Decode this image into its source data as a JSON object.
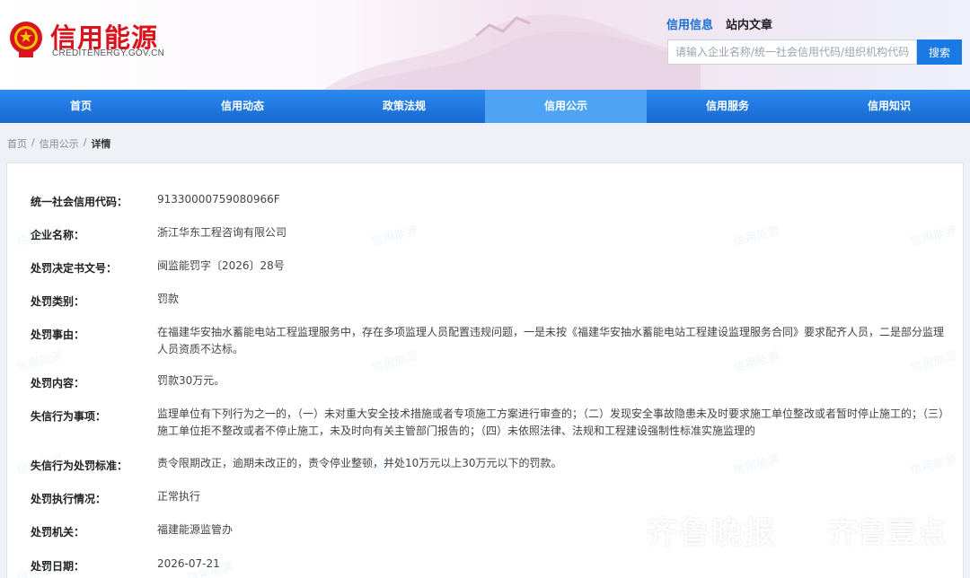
{
  "site": {
    "name": "信用能源",
    "domain": "CREDITENERGY.GOV.CN"
  },
  "search": {
    "tabs": [
      "信用信息",
      "站内文章"
    ],
    "placeholder": "请输入企业名称/统一社会信用代码/组织机构代码",
    "button": "搜索"
  },
  "nav": [
    "首页",
    "信用动态",
    "政策法规",
    "信用公示",
    "信用服务",
    "信用知识"
  ],
  "breadcrumb": [
    "首页",
    "信用公示",
    "详情"
  ],
  "details": [
    {
      "label": "统一社会信用代码：",
      "value": "91330000759080966F"
    },
    {
      "label": "企业名称：",
      "value": "浙江华东工程咨询有限公司"
    },
    {
      "label": "处罚决定书文号：",
      "value": "闽监能罚字〔2026〕28号"
    },
    {
      "label": "处罚类别：",
      "value": "罚款"
    },
    {
      "label": "处罚事由：",
      "value": "在福建华安抽水蓄能电站工程监理服务中，存在多项监理人员配置违规问题，一是未按《福建华安抽水蓄能电站工程建设监理服务合同》要求配齐人员，二是部分监理人员资质不达标。"
    },
    {
      "label": "处罚内容：",
      "value": "罚款30万元。"
    },
    {
      "label": "失信行为事项：",
      "value": "监理单位有下列行为之一的，（一）未对重大安全技术措施或者专项施工方案进行审查的；（二）发现安全事故隐患未及时要求施工单位整改或者暂时停止施工的；（三）施工单位拒不整改或者不停止施工，未及时向有关主管部门报告的；（四）未依照法律、法规和工程建设强制性标准实施监理的"
    },
    {
      "label": "失信行为处罚标准：",
      "value": "责令限期改正，逾期未改正的，责令停业整顿，并处10万元以上30万元以下的罚款。"
    },
    {
      "label": "处罚执行情况：",
      "value": "正常执行"
    },
    {
      "label": "处罚机关：",
      "value": "福建能源监管办"
    },
    {
      "label": "处罚日期：",
      "value": "2026-07-21"
    }
  ],
  "watermark": {
    "panel": "信用能源",
    "news": "齐鲁晚报",
    "box": "壹",
    "brand": "齐鲁壹点"
  },
  "colors": {
    "brand_red": "#d8141c",
    "nav_blue": "#1f78e0",
    "active_blue": "#4ea3f5"
  }
}
